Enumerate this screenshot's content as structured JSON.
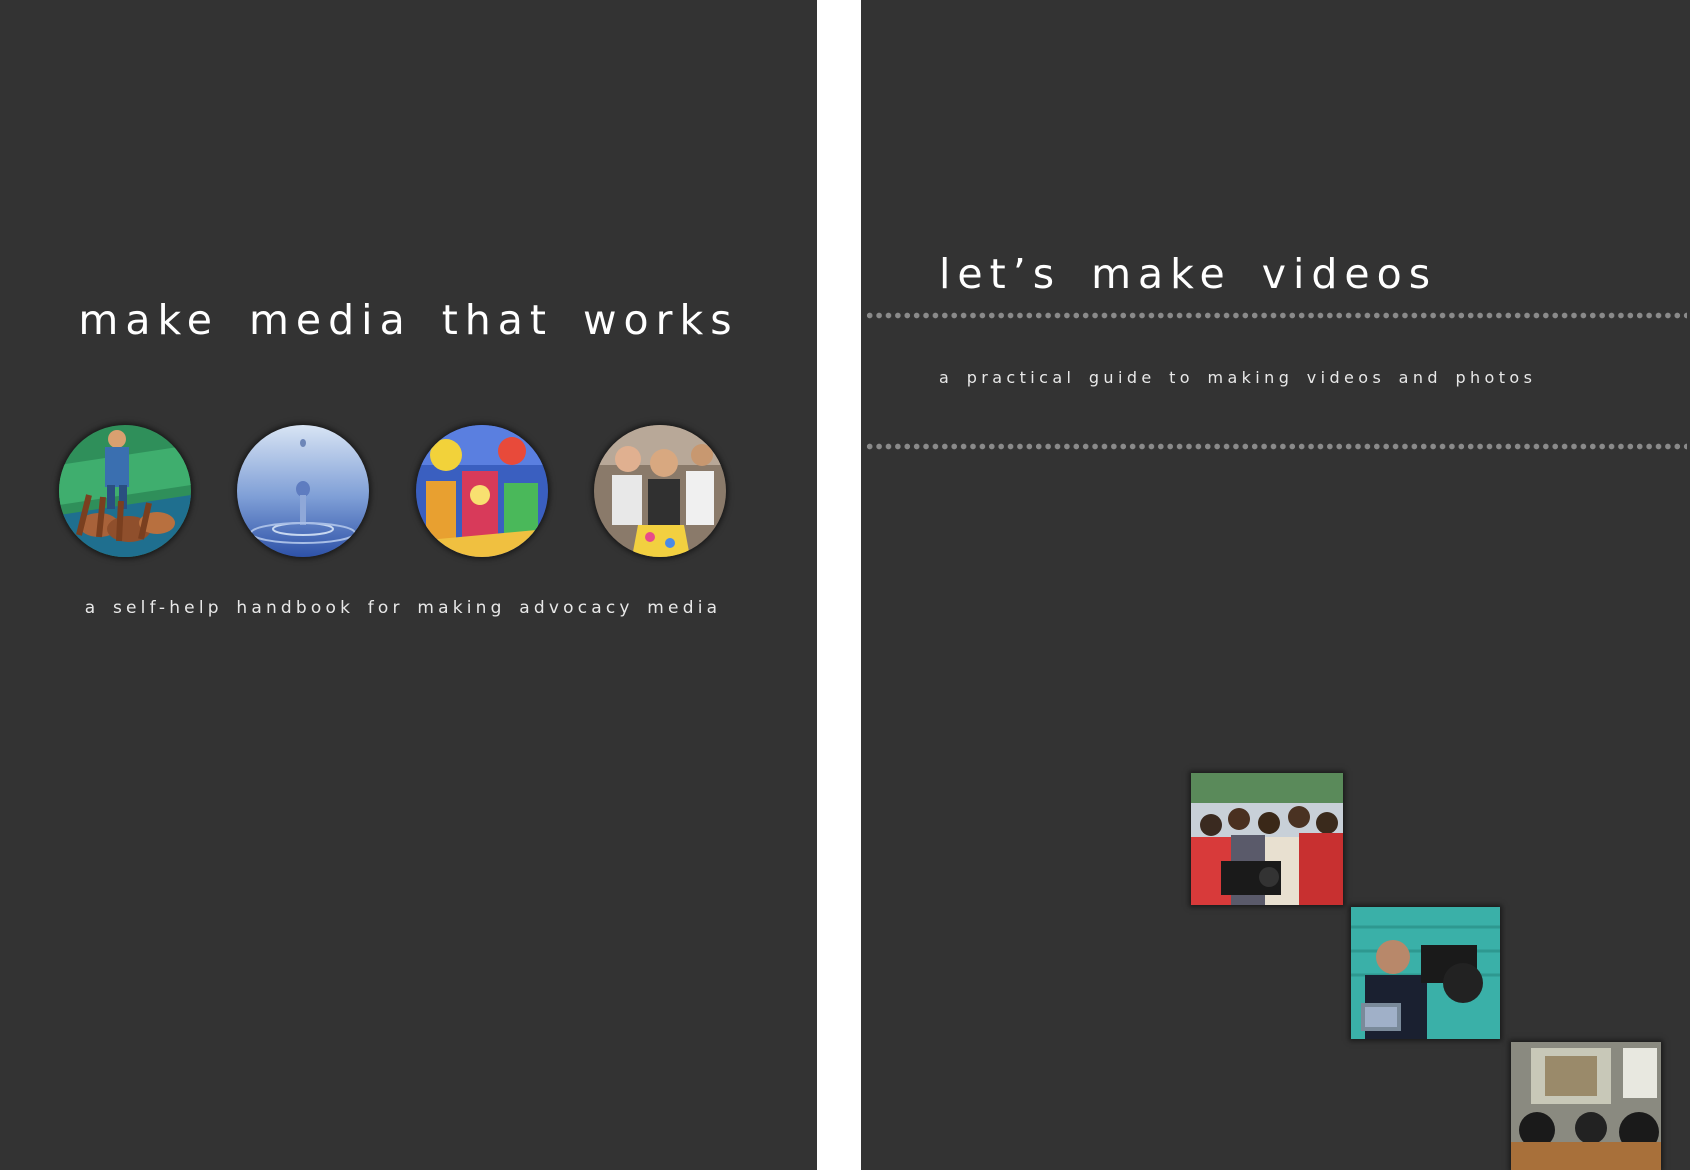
{
  "left_cover": {
    "title": "make media that works",
    "subtitle": "a self-help handbook for making advocacy media",
    "images": [
      {
        "name": "mural-hands-icon"
      },
      {
        "name": "water-drop-icon"
      },
      {
        "name": "colorful-painting-icon"
      },
      {
        "name": "crowd-celebration-icon"
      }
    ]
  },
  "right_cover": {
    "title": "let’s make videos",
    "subtitle": "a practical guide to making videos and photos",
    "images": [
      {
        "name": "crowd-with-camera-photo"
      },
      {
        "name": "cameraman-photo"
      },
      {
        "name": "screening-audience-photo"
      }
    ]
  },
  "colors": {
    "background": "#333333",
    "text": "#ffffff",
    "dots": "#8a8a8a",
    "gutter": "#ffffff"
  }
}
